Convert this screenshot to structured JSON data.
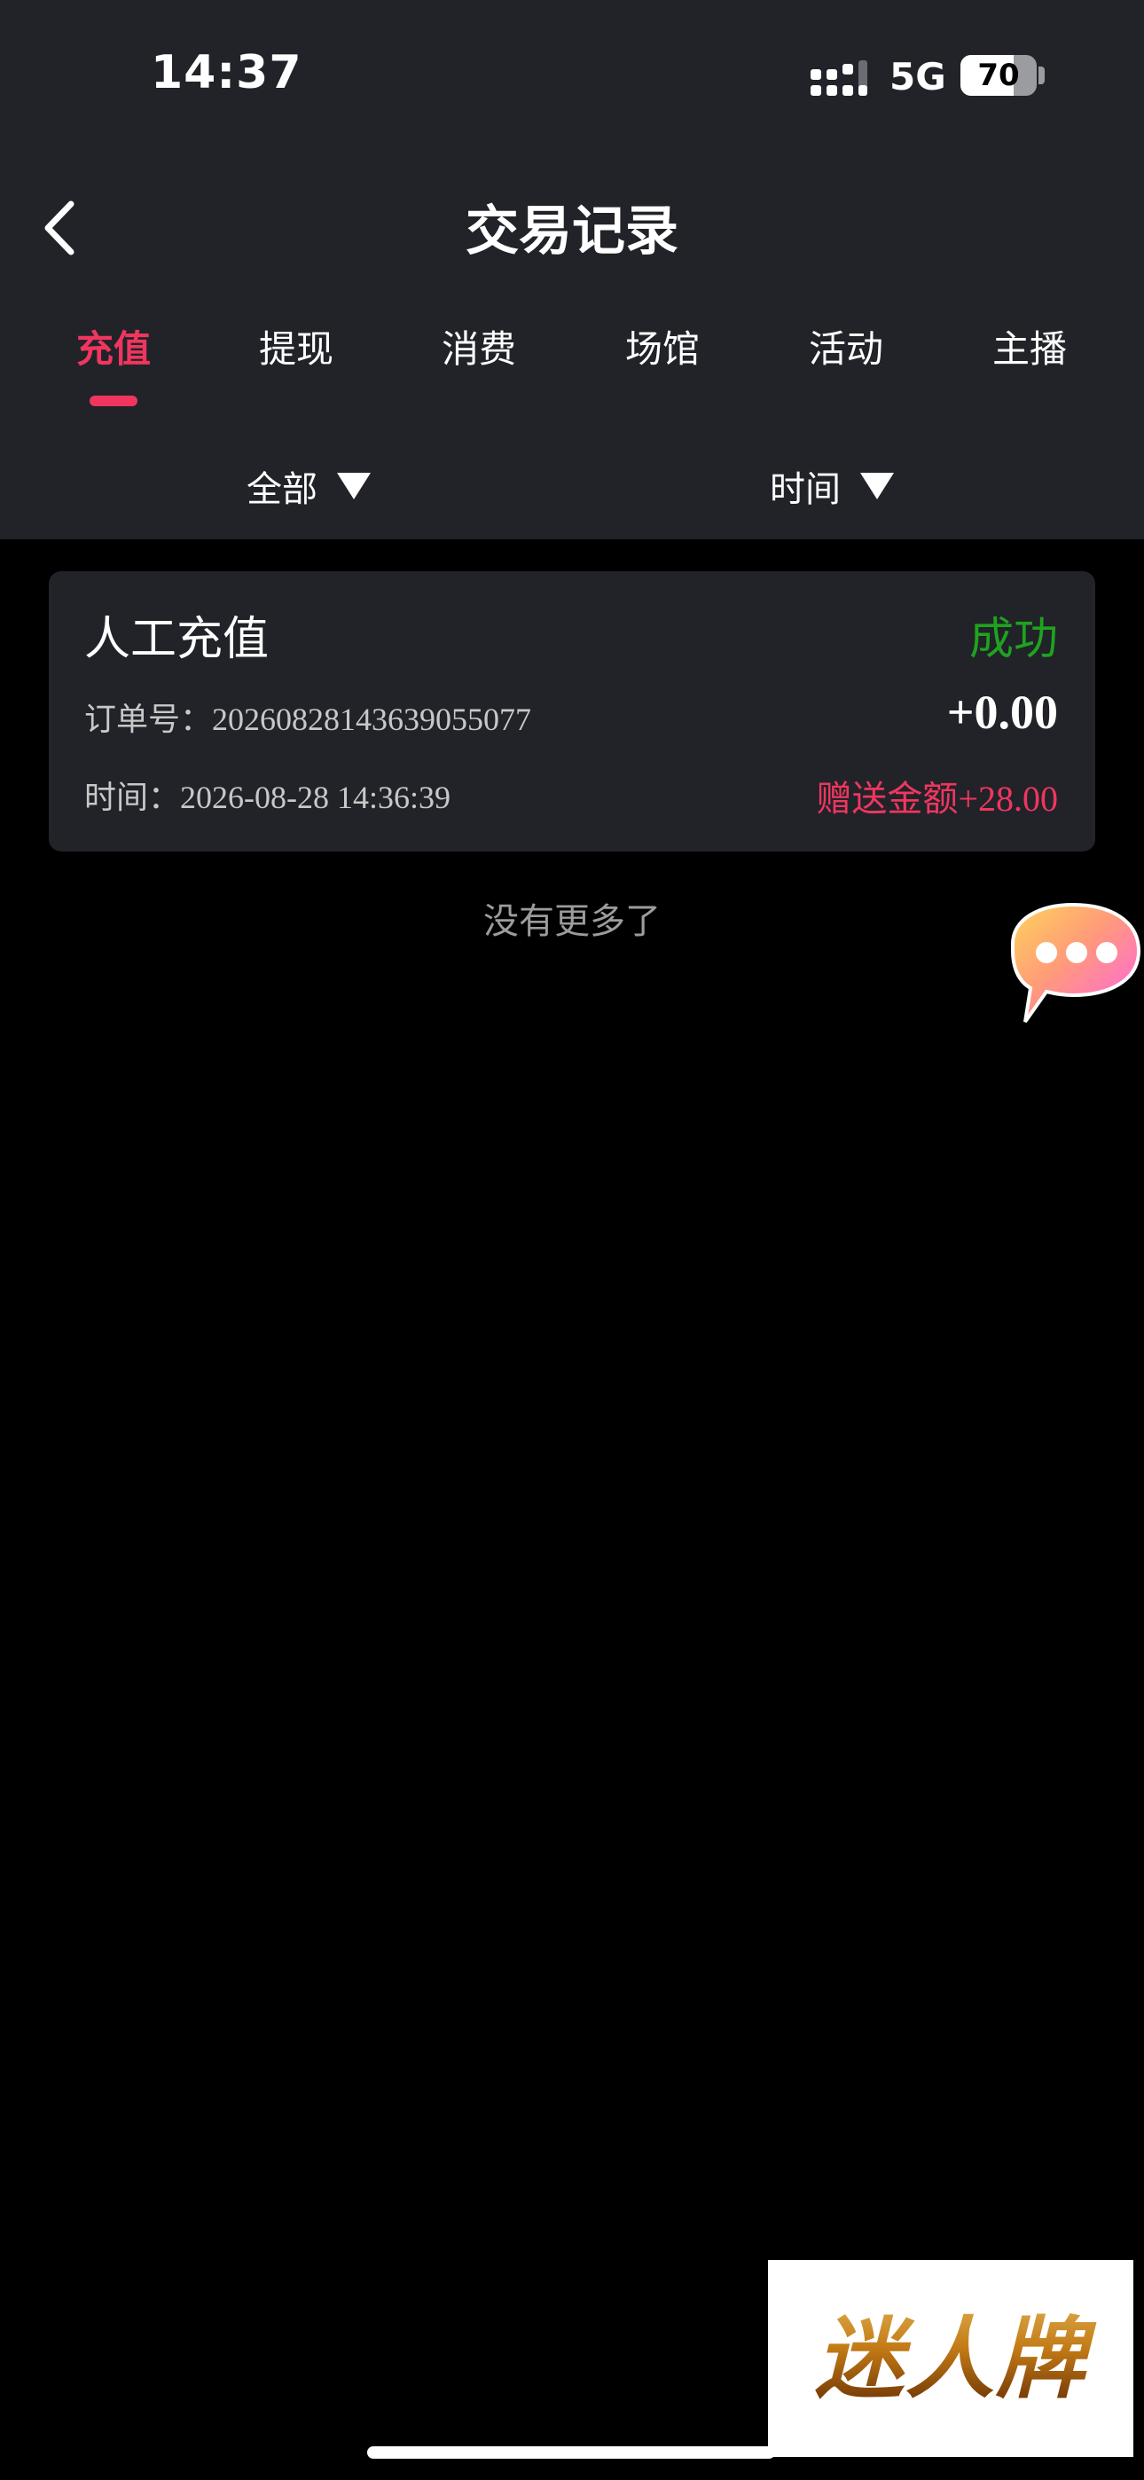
{
  "status_bar": {
    "time": "14:37",
    "network": "5G",
    "battery": "70",
    "battery_level": 0.7
  },
  "header": {
    "title": "交易记录",
    "back_icon": "chevron-left-icon"
  },
  "tabs": [
    {
      "label": "充值",
      "active": true
    },
    {
      "label": "提现",
      "active": false
    },
    {
      "label": "消费",
      "active": false
    },
    {
      "label": "场馆",
      "active": false
    },
    {
      "label": "活动",
      "active": false
    },
    {
      "label": "主播",
      "active": false
    }
  ],
  "filters": {
    "type_label": "全部",
    "time_label": "时间"
  },
  "records": [
    {
      "title": "人工充值",
      "status": "成功",
      "order_label": "订单号：",
      "order_no": "20260828143639055077",
      "amount": "+0.00",
      "time_label": "时间：",
      "time": "2026-08-28 14:36:39",
      "bonus_label": "赠送金额",
      "bonus_value": "+28.00"
    }
  ],
  "list_end_text": "没有更多了",
  "watermark_logo": "迷人牌",
  "colors": {
    "accent": "#f0365f",
    "success": "#1fa31f",
    "header_bg": "#212329",
    "page_bg": "#000000"
  }
}
